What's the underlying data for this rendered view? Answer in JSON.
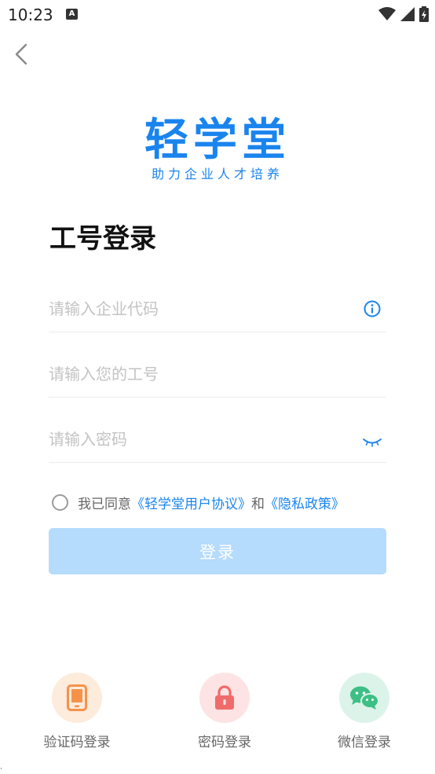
{
  "status_bar": {
    "time": "10:23",
    "notification_letter": "A"
  },
  "brand": {
    "title": "轻学堂",
    "subtitle": "助力企业人才培养"
  },
  "page": {
    "title": "工号登录"
  },
  "form": {
    "company_code_placeholder": "请输入企业代码",
    "employee_id_placeholder": "请输入您的工号",
    "password_placeholder": "请输入密码"
  },
  "agreement": {
    "prefix": "我已同意",
    "user_agreement": "《轻学堂用户协议》",
    "conjunction": "和",
    "privacy_policy": "《隐私政策》"
  },
  "login_button": {
    "label": "登录",
    "enabled": false
  },
  "alt_logins": [
    {
      "label": "验证码登录",
      "icon": "phone-icon",
      "bg": "#fdebdc",
      "color": "#f5924a"
    },
    {
      "label": "密码登录",
      "icon": "lock-icon",
      "bg": "#fde3e3",
      "color": "#f06b6b"
    },
    {
      "label": "微信登录",
      "icon": "wechat-icon",
      "bg": "#dcf3ea",
      "color": "#3dbf85"
    }
  ],
  "colors": {
    "accent": "#1a84ee",
    "button_disabled": "#b5dbfd"
  }
}
